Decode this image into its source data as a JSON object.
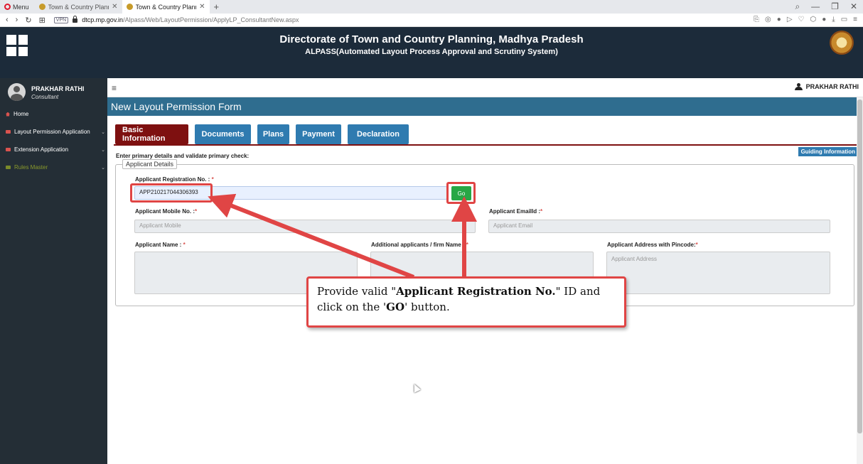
{
  "browser": {
    "menu_label": "Menu",
    "tabs": [
      {
        "title": "Town & Country Planning"
      },
      {
        "title": "Town & Country Planning"
      }
    ],
    "new_tab": "+",
    "vpn": "VPN",
    "url_domain": "dtcp.mp.gov.in",
    "url_path": "/Alpass/Web/LayoutPermission/ApplyLP_ConsultantNew.aspx"
  },
  "header": {
    "title": "Directorate of Town and Country Planning, Madhya Pradesh",
    "subtitle": "ALPASS(Automated Layout Process Approval and Scrutiny System)"
  },
  "sidebar": {
    "user_name": "PRAKHAR RATHI",
    "user_role": "Consultant",
    "items": [
      {
        "label": "Home"
      },
      {
        "label": "Layout Permission Application"
      },
      {
        "label": "Extension Application"
      },
      {
        "label": "Rules Master"
      }
    ]
  },
  "topbar": {
    "user_name": "PRAKHAR RATHI"
  },
  "form": {
    "title": "New Layout Permission Form",
    "tabs": [
      {
        "label": "Basic Information"
      },
      {
        "label": "Documents"
      },
      {
        "label": "Plans"
      },
      {
        "label": "Payment"
      },
      {
        "label": "Declaration"
      }
    ],
    "guiding_info": "Guiding Information",
    "primary_text": "Enter primary details and validate primary check:",
    "legend": "Applicant Details",
    "reg_label": "Applicant Registration No. : ",
    "reg_value": "APP210217044306393",
    "go_label": "Go",
    "mobile_label": "Applicant Mobile No. :",
    "mobile_placeholder": "Applicant Mobile",
    "email_label": "Applicant EmailId :",
    "email_placeholder": "Applicant Email",
    "name_label": "Applicant Name : ",
    "additional_label": "Additional applicants / firm Name : ",
    "address_label": "Applicant Address with Pincode:",
    "address_placeholder": "Applicant Address",
    "required_mark": "*"
  },
  "callout": {
    "text_part1": "Provide valid \"",
    "text_bold1": "Applicant Registration No.",
    "text_part2": "\" ID and click on the '",
    "text_bold2": "GO",
    "text_part3": "' button."
  },
  "colors": {
    "header_bg": "#1c2b3a",
    "sidebar_bg": "#242e36",
    "title_bar": "#2f6d8f",
    "tab_active": "#7e1010",
    "tab_default": "#2f7bb0",
    "go_button": "#28a745",
    "annotation": "#e04545"
  }
}
